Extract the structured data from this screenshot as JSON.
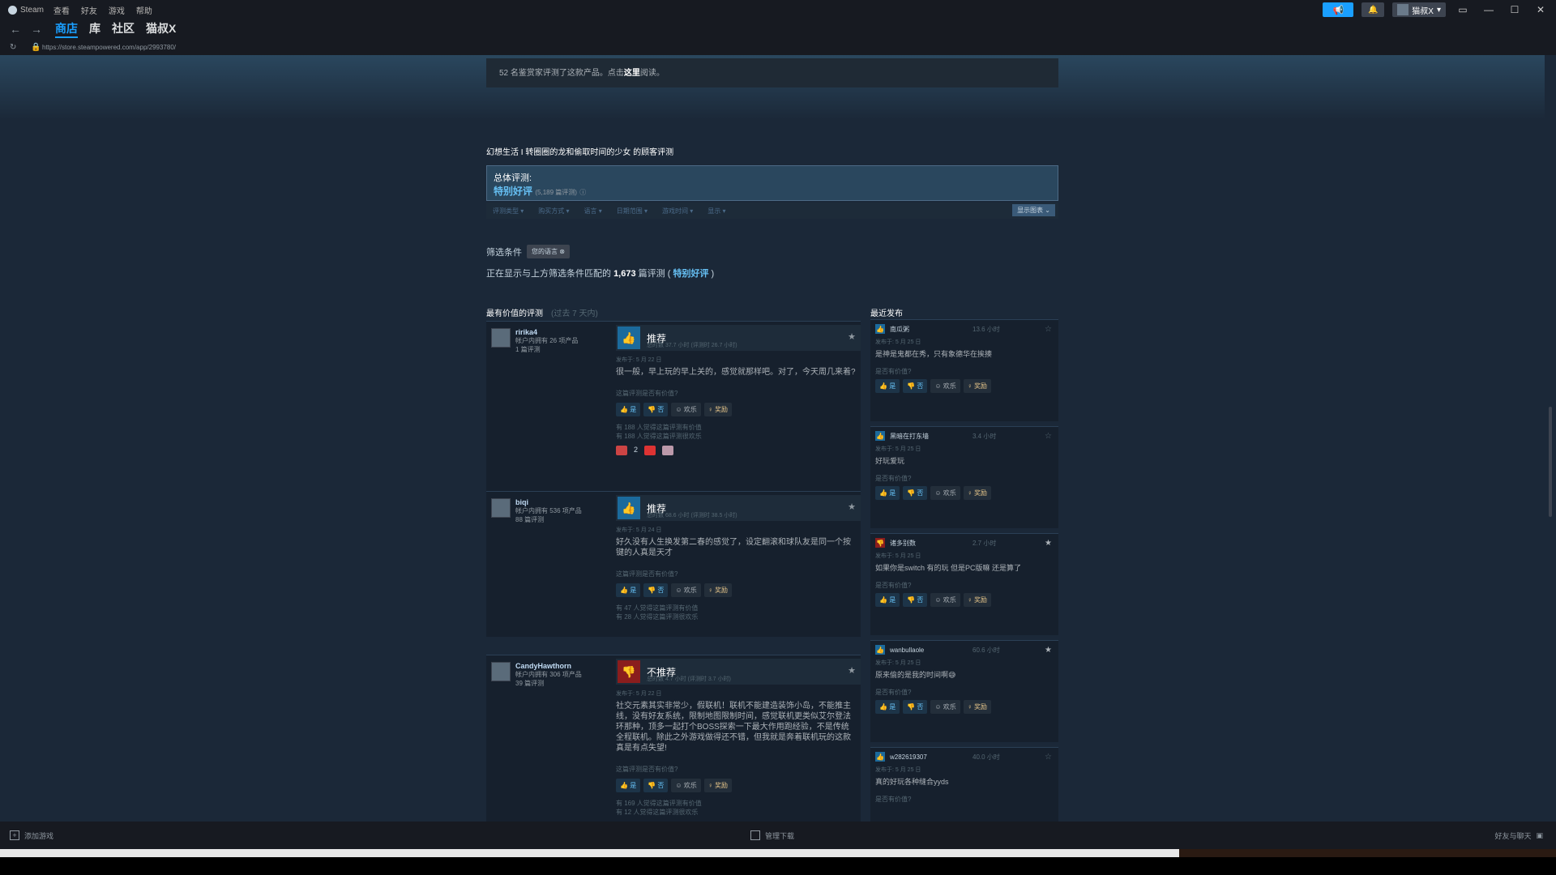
{
  "titlebar": {
    "app_name": "Steam",
    "menu": [
      "查看",
      "好友",
      "游戏",
      "帮助"
    ],
    "account_name": "猫叔X"
  },
  "nav": {
    "tabs": [
      "商店",
      "库",
      "社区",
      "猫叔X"
    ],
    "active_tab": "商店",
    "url": "https://store.steampowered.com/app/2993780/"
  },
  "curator": {
    "text_prefix": "52 名鉴赏家评测了这款产品。点击",
    "link": "这里",
    "text_suffix": "阅读。"
  },
  "reviews_section": {
    "title": "幻想生活 I 转圈圈的龙和偷取时间的少女 的顾客评测",
    "overall_label": "总体评测:",
    "overall_value": "特别好评",
    "overall_count": "(5,189 篇评测)",
    "filters": [
      "评测类型",
      "购买方式",
      "语言",
      "日期范围",
      "游戏时间",
      "显示"
    ],
    "show_chart": "显示图表",
    "filter_condition_label": "筛选条件",
    "filter_chip": "您的语言",
    "showing_prefix": "正在显示与上方筛选条件匹配的",
    "showing_count": "1,673",
    "showing_mid": "篇评测 (",
    "showing_rating": "特别好评",
    "showing_suffix": ")"
  },
  "most_helpful": {
    "title": "最有价值的评测",
    "subtitle": "(过去 7 天内)",
    "reviews": [
      {
        "user": "ririka4",
        "products": "帐户内拥有 26 项产品",
        "review_count": "1 篇评测",
        "verdict": "推荐",
        "hours": "总时数 37.7 小时 (评测时 26.7 小时)",
        "posted": "发布于: 5 月 22 日",
        "body": "很一般，早上玩的早上关的，感觉就那样吧。对了，今天周几来着?",
        "question": "这篇评测是否有价值?",
        "stat1": "有 188 人觉得这篇评测有价值",
        "stat2": "有 188 人觉得这篇评测很欢乐",
        "award_count": "2"
      },
      {
        "user": "biqi",
        "products": "帐户内拥有 536 项产品",
        "review_count": "88 篇评测",
        "verdict": "推荐",
        "hours": "总时数 68.6 小时 (评测时 38.5 小时)",
        "posted": "发布于: 5 月 24 日",
        "body": "好久没有人生换发第二春的感觉了，设定翻滚和球队友是同一个按键的人真是天才",
        "question": "这篇评测是否有价值?",
        "stat1": "有 47 人觉得这篇评测有价值",
        "stat2": "有 28 人觉得这篇评测很欢乐"
      },
      {
        "user": "CandyHawthorn",
        "products": "帐户内拥有 306 项产品",
        "review_count": "39 篇评测",
        "verdict": "不推荐",
        "hours": "总时数 4.7 小时 (评测时 3.7 小时)",
        "posted": "发布于: 5 月 22 日",
        "body": "社交元素其实非常少，假联机！联机不能建造装饰小岛，不能推主线，没有好友系统，限制地图限制时间，感觉联机更类似艾尔登法环那种，顶多一起打个BOSS探索一下最大作用跑经验，不是传统全程联机。除此之外游戏做得还不错，但我就是奔着联机玩的这款真是有点失望!",
        "question": "这篇评测是否有价值?",
        "stat1": "有 169 人觉得这篇评测有价值",
        "stat2": "有 12 人觉得这篇评测很欢乐"
      }
    ],
    "btn_yes": "是",
    "btn_no": "否",
    "btn_funny": "欢乐",
    "btn_award": "奖励"
  },
  "recent": {
    "title": "最近发布",
    "items": [
      {
        "user": "南瓜粥",
        "hours": "13.6 小时",
        "posted": "发布于: 5 月 25 日",
        "text": "是神是鬼都在秀，只有象德华在挨揍",
        "positive": true,
        "starred": false
      },
      {
        "user": "黑暗在打东墙",
        "hours": "3.4 小时",
        "posted": "发布于: 5 月 25 日",
        "text": "好玩爱玩",
        "positive": true,
        "starred": false
      },
      {
        "user": "诸多别数",
        "hours": "2.7 小时",
        "posted": "发布于: 5 月 25 日",
        "text": "如果你是switch 有的玩 但是PC版嘛 还是算了",
        "positive": false,
        "starred": true
      },
      {
        "user": "wanbullaole",
        "hours": "60.6 小时",
        "posted": "发布于: 5 月 25 日",
        "text": "原来偷的是我的时间啊😅",
        "positive": true,
        "starred": true
      },
      {
        "user": "w282619307",
        "hours": "40.0 小时",
        "posted": "发布于: 5 月 25 日",
        "text": "真的好玩各种缝合yyds",
        "positive": true,
        "starred": false
      }
    ],
    "question": "是否有价值?"
  },
  "bottombar": {
    "add_game": "添加游戏",
    "downloads": "管理下载",
    "friends": "好友与聊天"
  },
  "colors": {
    "accent": "#1a9fff",
    "positive": "#66c0f4",
    "bg": "#1b2838"
  }
}
